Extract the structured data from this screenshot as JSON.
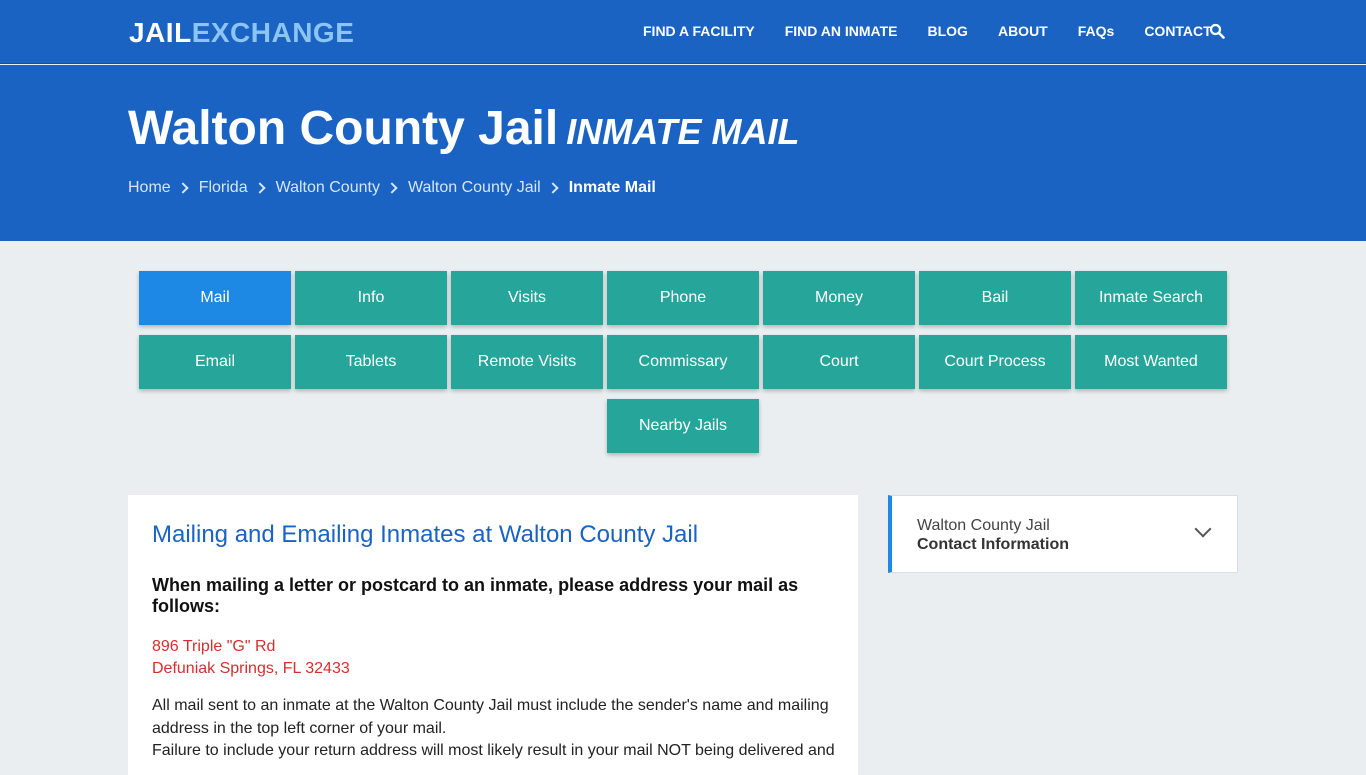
{
  "logo": {
    "part1": "JAIL",
    "part2": "EXCHANGE"
  },
  "nav": {
    "items": [
      "FIND A FACILITY",
      "FIND AN INMATE",
      "BLOG",
      "ABOUT",
      "FAQs",
      "CONTACT"
    ],
    "search_icon": "search-icon"
  },
  "hero": {
    "title": "Walton County Jail",
    "subtitle": "INMATE MAIL",
    "breadcrumb": [
      "Home",
      "Florida",
      "Walton County",
      "Walton County Jail",
      "Inmate Mail"
    ]
  },
  "tabs": [
    {
      "label": "Mail",
      "active": true
    },
    {
      "label": "Info"
    },
    {
      "label": "Visits"
    },
    {
      "label": "Phone"
    },
    {
      "label": "Money"
    },
    {
      "label": "Bail"
    },
    {
      "label": "Inmate Search"
    },
    {
      "label": "Email"
    },
    {
      "label": "Tablets"
    },
    {
      "label": "Remote Visits"
    },
    {
      "label": "Commissary"
    },
    {
      "label": "Court"
    },
    {
      "label": "Court Process"
    },
    {
      "label": "Most Wanted"
    },
    {
      "label": "Nearby Jails"
    }
  ],
  "main": {
    "heading": "Mailing and Emailing Inmates at Walton County Jail",
    "subheading": "When mailing a letter or postcard to an inmate, please address your mail as follows:",
    "address_line1": "896 Triple \"G\" Rd",
    "address_line2": "Defuniak Springs, FL 32433",
    "paragraph1": "All mail sent to an inmate at the Walton County Jail must include the sender's name and mailing address in the top left corner of your mail.",
    "paragraph2": "Failure to include your return address will most likely result in your mail NOT being delivered and"
  },
  "sidebar": {
    "line1": "Walton County Jail",
    "line2": "Contact Information",
    "toggle_icon": "chevron-down-icon"
  },
  "colors": {
    "header_blue": "#1a63c2",
    "tab_teal": "#26a69a",
    "tab_active": "#1e88e5",
    "address_red": "#d32f2f",
    "page_bg": "#ebeef0"
  }
}
